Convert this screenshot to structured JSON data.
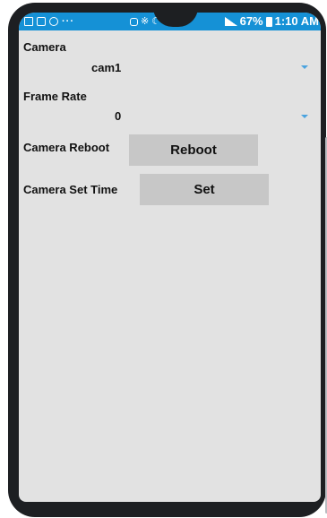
{
  "statusbar": {
    "left_icons": [
      "image-icon",
      "gallery-icon",
      "clock-icon"
    ],
    "dots": "···",
    "mid_icons": [
      "alarm-icon",
      "bluetooth-icon",
      "mute-icon"
    ],
    "battery_percent": "67%",
    "time": "1:10 AM"
  },
  "form": {
    "camera": {
      "label": "Camera",
      "value": "cam1"
    },
    "frame_rate": {
      "label": "Frame Rate",
      "value": "0"
    },
    "camera_reboot": {
      "label": "Camera Reboot",
      "button": "Reboot"
    },
    "camera_set_time": {
      "label": "Camera Set Time",
      "button": "Set"
    }
  },
  "colors": {
    "statusbar": "#1591d6",
    "background": "#e2e2e2",
    "button": "#c7c7c7",
    "spinner_arrow": "#4aa3df"
  }
}
